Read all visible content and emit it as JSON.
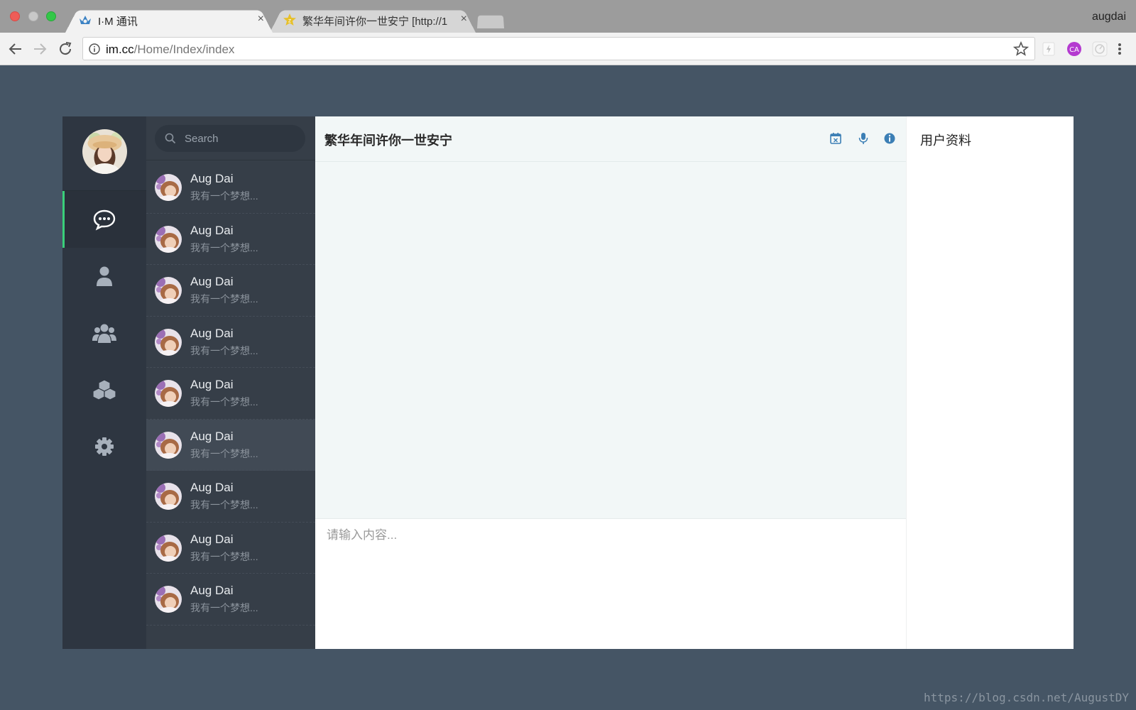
{
  "browser": {
    "tabs": [
      {
        "title": "I·M 通讯",
        "close": "×"
      },
      {
        "title": "繁华年间许你一世安宁 [http://1",
        "close": "×"
      }
    ],
    "profile": "augdai",
    "url_host": "im.cc",
    "url_path": "/Home/Index/index"
  },
  "app": {
    "nav": [
      {
        "icon": "chat-bubble-icon",
        "active": true
      },
      {
        "icon": "user-icon",
        "active": false
      },
      {
        "icon": "group-icon",
        "active": false
      },
      {
        "icon": "cubes-icon",
        "active": false
      },
      {
        "icon": "gear-icon",
        "active": false
      }
    ],
    "search_placeholder": "Search",
    "conversations": [
      {
        "name": "Aug Dai",
        "preview": "我有一个梦想..."
      },
      {
        "name": "Aug Dai",
        "preview": "我有一个梦想..."
      },
      {
        "name": "Aug Dai",
        "preview": "我有一个梦想..."
      },
      {
        "name": "Aug Dai",
        "preview": "我有一个梦想..."
      },
      {
        "name": "Aug Dai",
        "preview": "我有一个梦想..."
      },
      {
        "name": "Aug Dai",
        "preview": "我有一个梦想..."
      },
      {
        "name": "Aug Dai",
        "preview": "我有一个梦想..."
      },
      {
        "name": "Aug Dai",
        "preview": "我有一个梦想..."
      },
      {
        "name": "Aug Dai",
        "preview": "我有一个梦想..."
      }
    ],
    "selected_conversation": 5,
    "chat_title": "繁华年间许你一世安宁",
    "chat_header_icons": [
      "calendar-icon",
      "microphone-icon",
      "info-icon"
    ],
    "composer_placeholder": "请输入内容...",
    "profile_title": "用户资料"
  },
  "watermark": "https://blog.csdn.net/AugustDY",
  "colors": {
    "page_bg": "#455565",
    "rail_bg": "#2e3641",
    "list_bg": "#363e48",
    "active_accent": "#3ad07a",
    "icon_blue": "#3c7fb5"
  }
}
